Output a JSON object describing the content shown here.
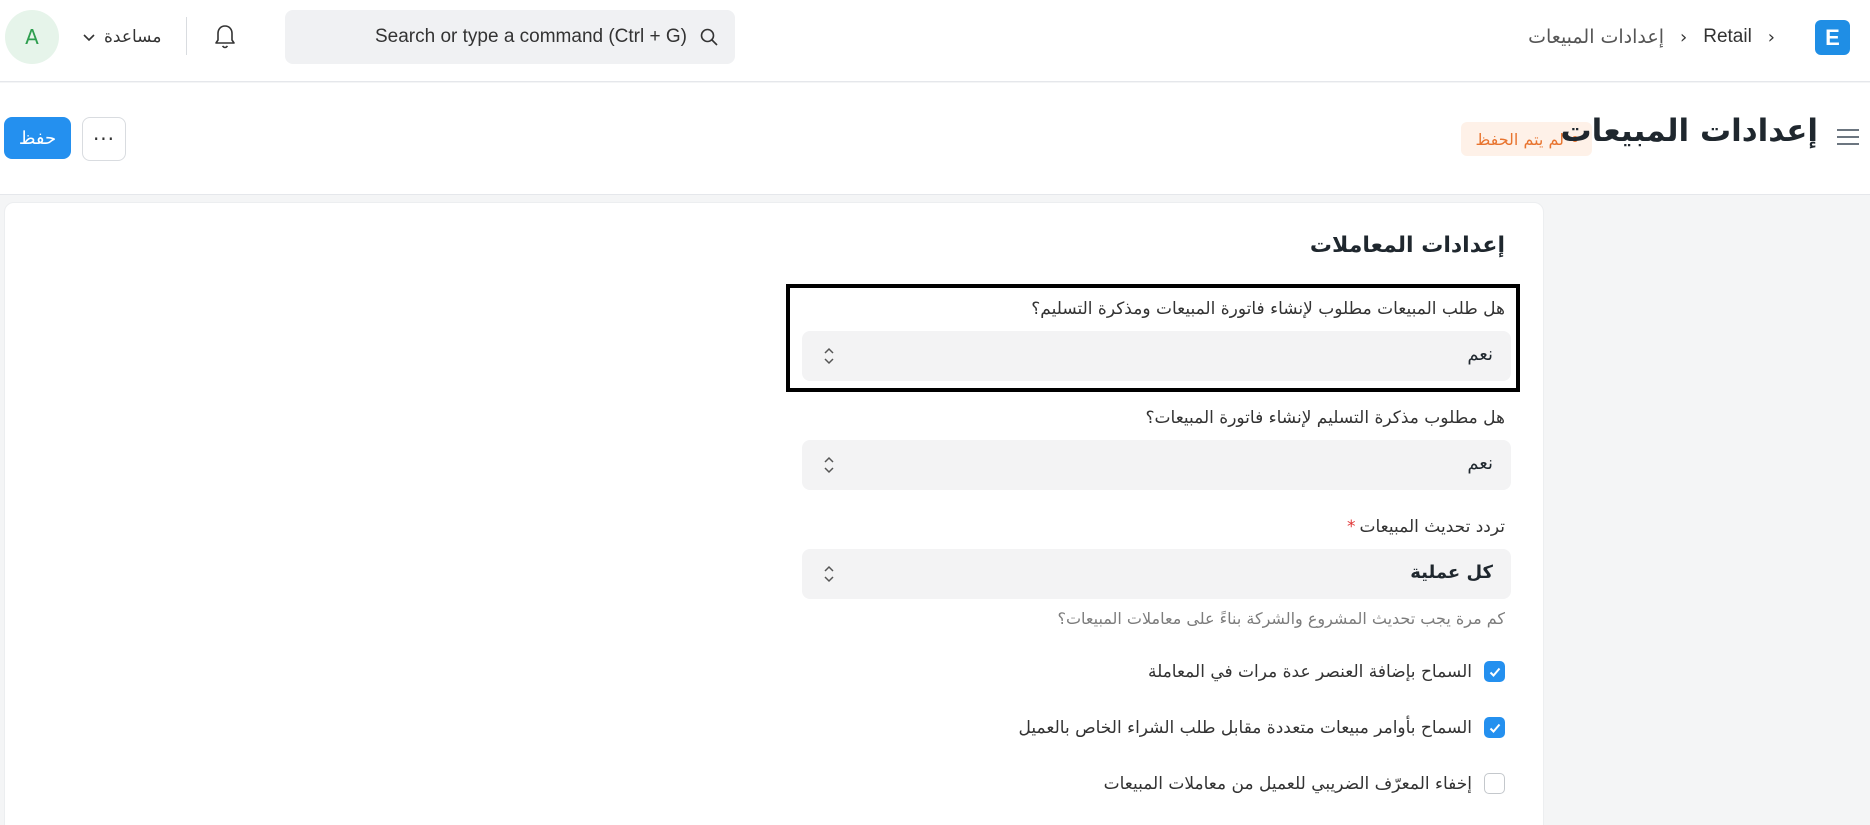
{
  "navbar": {
    "avatar_letter": "A",
    "help_label": "مساعدة",
    "search_placeholder": "Search or type a command (Ctrl + G)",
    "breadcrumb": {
      "root": "Retail",
      "current": "إعدادات المبيعات"
    },
    "logo_letter": "E"
  },
  "page": {
    "title": "إعدادات المبيعات",
    "status": "لم يتم الحفظ",
    "save_label": "حفظ",
    "more_label": "···"
  },
  "form": {
    "section_title": "إعدادات المعاملات",
    "fields": [
      {
        "label": "هل طلب المبيعات مطلوب لإنشاء فاتورة المبيعات ومذكرة التسليم؟",
        "value": "نعم"
      },
      {
        "label": "هل مطلوب مذكرة التسليم لإنشاء فاتورة المبيعات؟",
        "value": "نعم"
      },
      {
        "label": "تردد تحديث المبيعات",
        "value": "كل عملية",
        "required_mark": "*",
        "help": "كم مرة يجب تحديث المشروع والشركة بناءً على معاملات المبيعات؟"
      }
    ],
    "checks": [
      {
        "label": "السماح بإضافة العنصر عدة مرات في المعاملة",
        "checked": true
      },
      {
        "label": "السماح بأوامر مبيعات متعددة مقابل طلب الشراء الخاص بالعميل",
        "checked": true
      },
      {
        "label": "إخفاء المعرّف الضريبي للعميل من معاملات المبيعات",
        "checked": false
      }
    ]
  },
  "colors": {
    "primary": "#2490ef",
    "status_orange": "#e8742f"
  }
}
